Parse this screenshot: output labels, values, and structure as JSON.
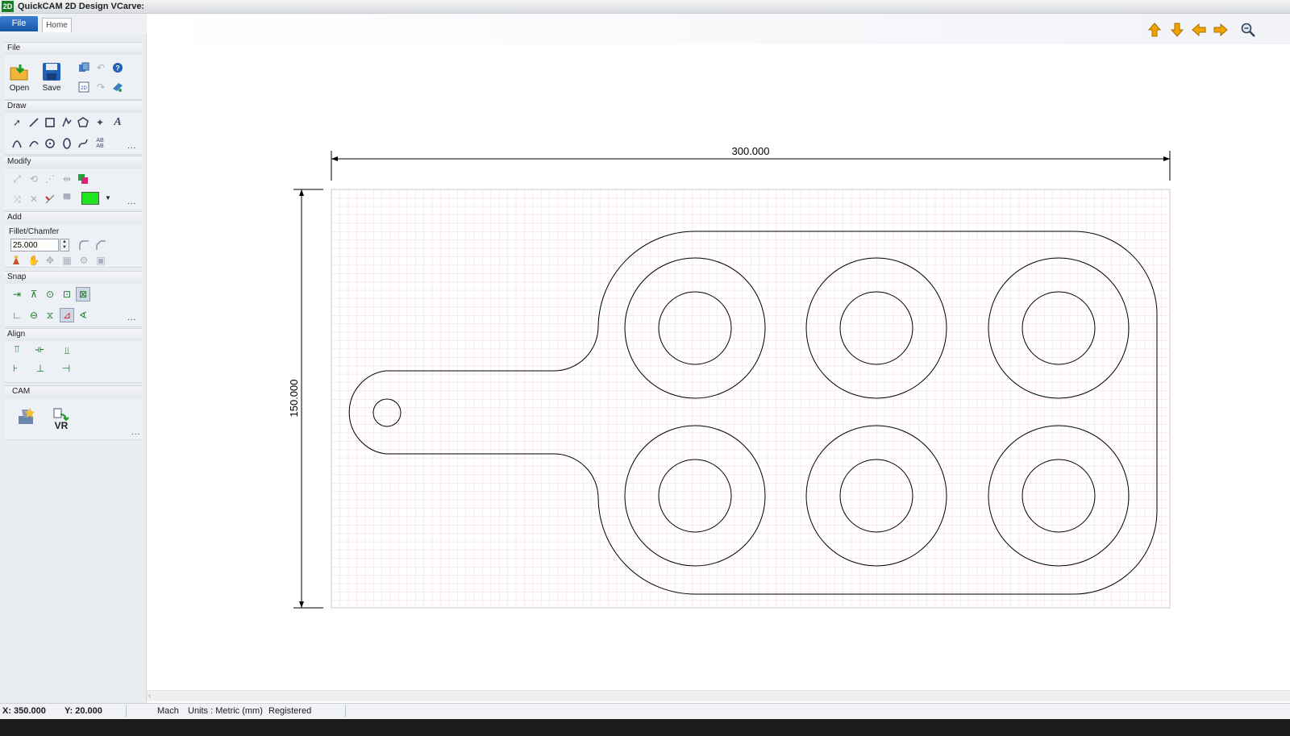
{
  "window": {
    "title": "QuickCAM 2D Design VCarve:",
    "icon_text": "2D"
  },
  "ribbon": {
    "tabs": [
      {
        "label": "File"
      },
      {
        "label": "Home"
      }
    ],
    "groups": {
      "file": {
        "label": "File",
        "open_label": "Open",
        "save_label": "Save"
      },
      "draw": {
        "label": "Draw"
      },
      "modify": {
        "label": "Modify",
        "current_color": "#1ee61e"
      },
      "add": {
        "label": "Add",
        "fillet_label": "Fillet/Chamfer",
        "fillet_value": "25.000"
      },
      "snap": {
        "label": "Snap"
      },
      "align": {
        "label": "Align"
      },
      "cam": {
        "label": "CAM",
        "vr_label": "VR"
      }
    },
    "more_label": "..."
  },
  "drawing": {
    "width_dimension": "300.000",
    "height_dimension": "150.000",
    "grid_color": "#f3c9c9",
    "line_color": "#000000"
  },
  "navigation": {
    "icons": [
      "arrow-up-icon",
      "arrow-down-icon",
      "arrow-left-icon",
      "arrow-right-icon",
      "zoom-icon"
    ],
    "accent_color": "#f2a300"
  },
  "status": {
    "x_coord": "X: 350.000",
    "y_coord": "Y: 20.000",
    "mode": "Mach",
    "units": "Units : Metric (mm)",
    "registration": "Registered"
  }
}
